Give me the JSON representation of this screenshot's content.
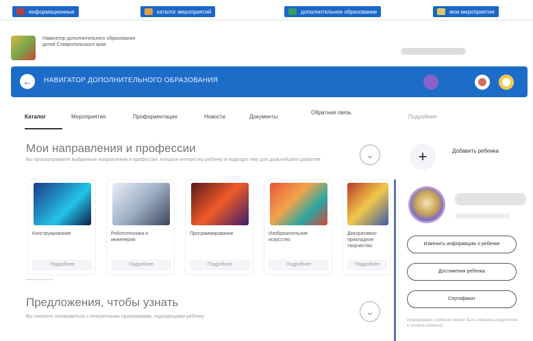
{
  "topbar": [
    {
      "label": "информационные",
      "color": "#c43a3a"
    },
    {
      "label": "каталог мероприятий",
      "color": "#f0a33b"
    },
    {
      "label": "дополнительное образование",
      "color": "#3ca25a"
    },
    {
      "label": "мои мероприятия",
      "color": "#f5d15a"
    }
  ],
  "org": {
    "text": "Навигатор дополнительного образования детей Ставропольского края"
  },
  "nav": {
    "title": "НАВИГАТОР ДОПОЛНИТЕЛЬНОГО ОБРАЗОВАНИЯ"
  },
  "tabs": [
    "Каталог",
    "Мероприятия",
    "Профориентация",
    "Новости",
    "Документы",
    "Обратная связь",
    "Подробнее"
  ],
  "section1": {
    "title": "Мои направления и профессии",
    "subtitle": "Вы просматриваете выбранные направления и профессии, которые интересны ребенку и подходят ему для дальнейшего развития"
  },
  "cards": [
    {
      "title": "Конструирование",
      "tag": "Подробнее",
      "c1": "#1e3a8a",
      "c2": "#22c3e6"
    },
    {
      "title": "Робототехника и инженерия",
      "tag": "Подробнее",
      "c1": "#e9eef5",
      "c2": "#3b4657"
    },
    {
      "title": "Программирование",
      "tag": "Подробнее",
      "c1": "#5a1a1a",
      "c2": "#f05a28"
    },
    {
      "title": "Изобразительное искусство",
      "tag": "Подробнее",
      "c1": "#e8563a",
      "c2": "#2aa7a0"
    },
    {
      "title": "Декоративно-прикладное творчество",
      "tag": "Подробнее",
      "c1": "#b83a2a",
      "c2": "#f1c84a"
    }
  ],
  "section2": {
    "title": "Предложения, чтобы узнать",
    "subtitle": "Вы сможете ознакомиться с интересными программами, подходящими ребенку"
  },
  "sidebar": {
    "add_child": "Добавить ребенка",
    "pills": [
      "Изменить информацию о ребенке",
      "Достижения ребенка",
      "Сертификат"
    ],
    "note": "Информация о ребенке может быть изменена родителем в личном кабинете"
  },
  "icons": {
    "back": "arrow-left-icon",
    "add": "plus-icon",
    "expand": "chevron-down-icon"
  }
}
